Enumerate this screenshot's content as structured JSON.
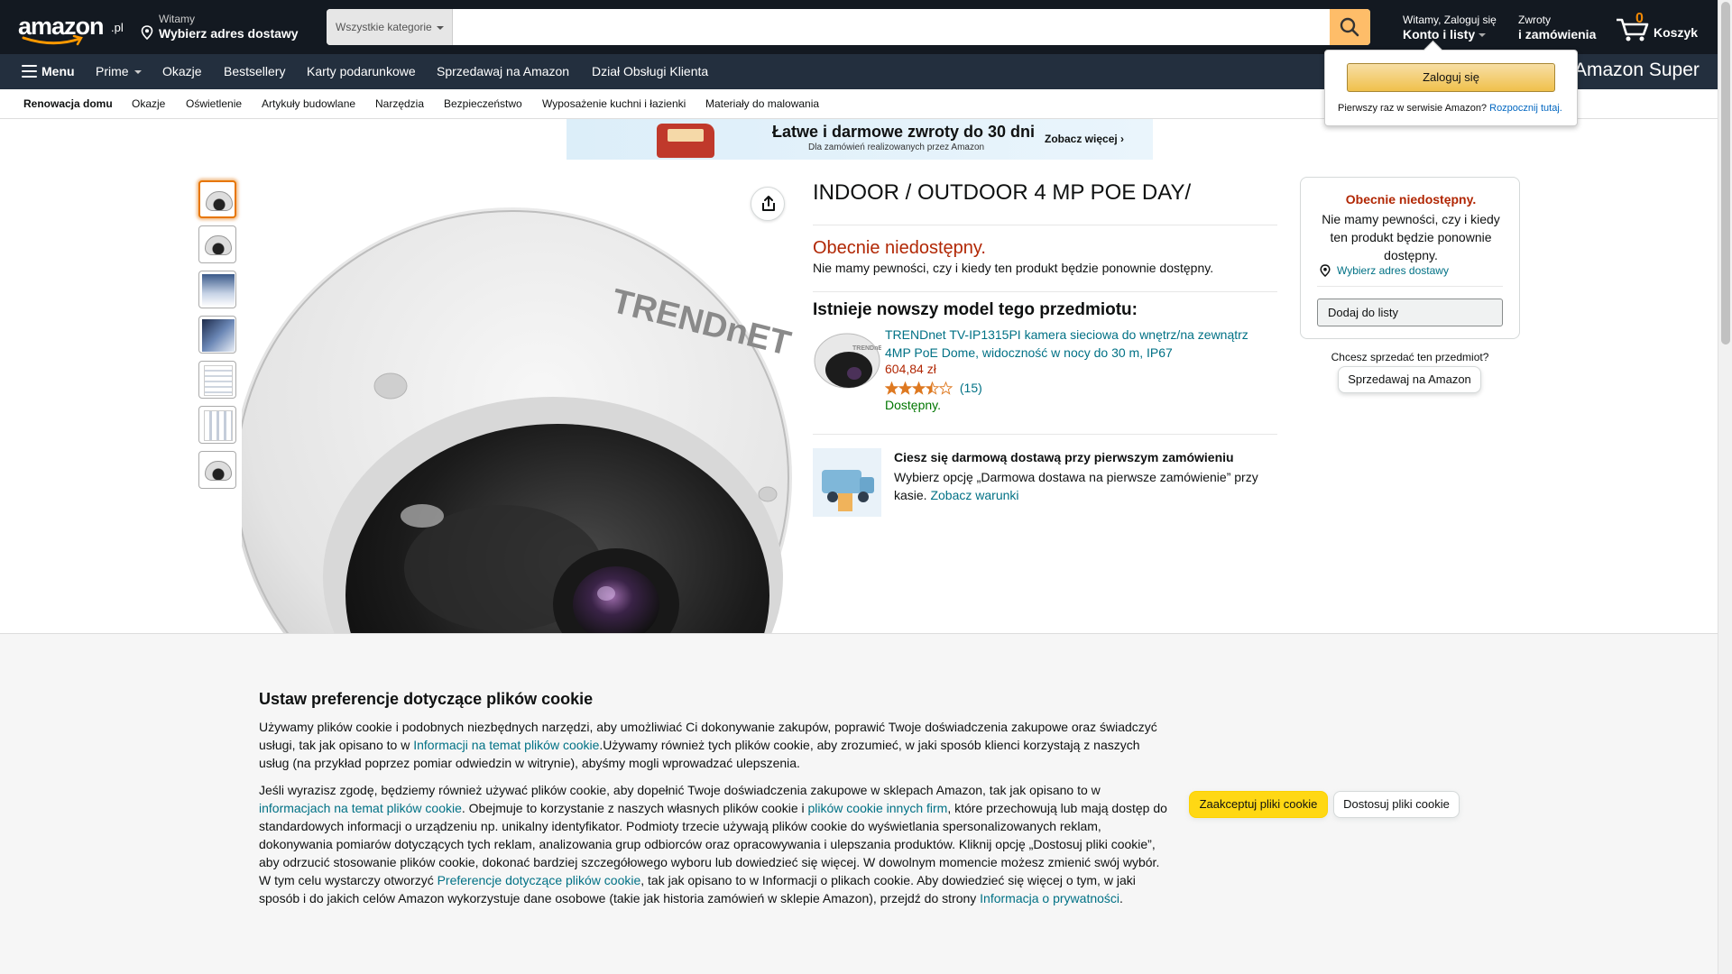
{
  "header": {
    "logo_text": "amazon",
    "logo_tld": ".pl",
    "deliver_small": "Witamy",
    "deliver_big": "Wybierz adres dostawy",
    "search_category": "Wszystkie kategorie",
    "search_value": "",
    "search_placeholder": "",
    "account_small": "Witamy, Zaloguj się",
    "account_big": "Konto i listy",
    "returns_small": "Zwroty",
    "returns_big": "i zamówienia",
    "cart_count": "0",
    "cart_label": "Koszyk"
  },
  "nav": {
    "menu": "Menu",
    "prime": "Prime",
    "items": [
      "Okazje",
      "Bestsellery",
      "Karty podarunkowe",
      "Sprzedawaj na Amazon",
      "Dział Obsługi Klienta"
    ],
    "promo": "Amazon Super"
  },
  "subnav": {
    "items": [
      "Renowacja domu",
      "Okazje",
      "Oświetlenie",
      "Artykuły budowlane",
      "Narzędzia",
      "Bezpieczeństwo",
      "Wyposażenie kuchni i łazienki",
      "Materiały do malowania"
    ]
  },
  "banner": {
    "title": "Łatwe i darmowe zwroty do 30 dni",
    "subtitle": "Dla zamówień realizowanych przez Amazon",
    "cta": "Zobacz więcej ›"
  },
  "product": {
    "brand_on_image": "TRENDNET",
    "title": "INDOOR / OUTDOOR 4 MP POE DAY/",
    "unavailable": "Obecnie niedostępny.",
    "unavailable_desc": "Nie mamy pewności, czy i kiedy ten produkt będzie ponownie dostępny.",
    "newer_heading": "Istnieje nowszy model tego przedmiotu:",
    "newer_link": "TRENDnet TV-IP1315PI kamera sieciowa do wnętrz/na zewnątrz 4MP PoE Dome, widoczność w nocy do 30 m, IP67",
    "newer_price": "604,84 zł",
    "newer_rating": 3.5,
    "newer_reviews": "(15)",
    "newer_availability": "Dostępny.",
    "free_title": "Ciesz się darmową dostawą przy pierwszym zamówieniu",
    "free_desc": "Wybierz opcję „Darmowa dostawa na pierwsze zamówienie” przy kasie.",
    "free_link": "Zobacz warunki"
  },
  "buybox": {
    "unavailable": "Obecnie niedostępny.",
    "desc": "Nie mamy pewności, czy i kiedy ten produkt będzie ponownie dostępny.",
    "address": "Wybierz adres dostawy",
    "add_to_list": "Dodaj do listy",
    "sell_question": "Chcesz sprzedać ten przedmiot?",
    "sell_button": "Sprzedawaj na Amazon"
  },
  "flyout": {
    "signin": "Zaloguj się",
    "new_customer": "Pierwszy raz w serwisie Amazon?",
    "start_here": "Rozpocznij tutaj."
  },
  "cookie": {
    "title": "Ustaw preferencje dotyczące plików cookie",
    "p1_a": "Używamy plików cookie i podobnych niezbędnych narzędzi, aby umożliwiać Ci dokonywanie zakupów, poprawić Twoje doświadczenia zakupowe oraz świadczyć usługi, tak jak opisano to w ",
    "p1_link": "Informacji na temat plików cookie",
    "p1_b": ".Używamy również tych plików cookie, aby zrozumieć, w jaki sposób klienci korzystają z naszych usług (na przykład poprzez pomiar odwiedzin w witrynie), abyśmy mogli wprowadzać ulepszenia.",
    "p2_a": "Jeśli wyrazisz zgodę, będziemy również używać plików cookie, aby dopełnić Twoje doświadczenia zakupowe w sklepach Amazon, tak jak opisano to w ",
    "p2_link1": "informacjach na temat plików cookie",
    "p2_b": ". Obejmuje to korzystanie z naszych własnych plików cookie i ",
    "p2_link2": "plików cookie innych firm",
    "p2_c": ", które przechowują lub mają dostęp do standardowych informacji o urządzeniu np. unikalny identyfikator. Podmioty trzecie używają plików cookie do wyświetlania spersonalizowanych reklam, dokonywania pomiarów dotyczących tych reklam, analizowania grup odbiorców oraz opracowywania i ulepszania produktów. Kliknij opcję „Dostosuj pliki cookie”, aby odrzucić stosowanie plików cookie, dokonać bardziej szczegółowego wyboru lub dowiedzieć się więcej. W dowolnym momencie możesz zmienić swój wybór. W tym celu wystarczy otworzyć ",
    "p2_link3": "Preferencje dotyczące plików cookie",
    "p2_d": ", tak jak opisano to w Informacji o plikach cookie. Aby dowiedzieć się więcej o tym, w jaki sposób i do jakich celów Amazon wykorzystuje dane osobowe (takie jak historia zamówień w sklepie Amazon), przejdź do strony ",
    "p2_link4": "Informacja o prywatności",
    "p2_e": ".",
    "accept": "Zaakceptuj pliki cookie",
    "customize": "Dostosuj pliki cookie"
  },
  "colors": {
    "nav_dark": "#131921",
    "nav_secondary": "#232f3e",
    "search_button": "#febd69",
    "price": "#b12704",
    "link": "#007185",
    "in_stock": "#007600",
    "accept_button": "#ffd814"
  }
}
